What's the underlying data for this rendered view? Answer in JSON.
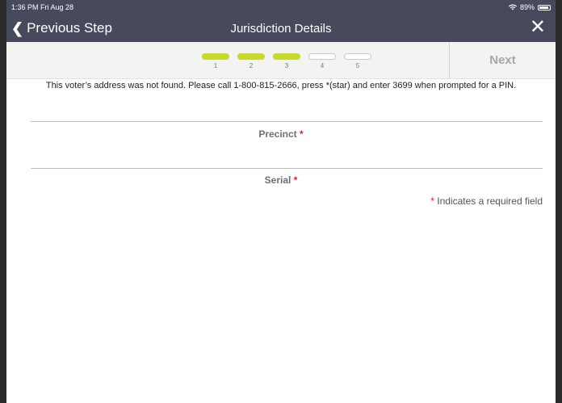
{
  "status_bar": {
    "time_date": "1:36 PM  Fri Aug 28",
    "battery": "89%",
    "wifi_icon": "wifi-icon",
    "battery_icon": "battery-icon"
  },
  "nav": {
    "back_label": "Previous Step",
    "title": "Jurisdiction Details",
    "close_icon": "close-icon"
  },
  "progress": {
    "steps": [
      {
        "label": "1",
        "complete": true
      },
      {
        "label": "2",
        "complete": true
      },
      {
        "label": "3",
        "complete": true
      },
      {
        "label": "4",
        "complete": false
      },
      {
        "label": "5",
        "complete": false
      }
    ],
    "next_label": "Next"
  },
  "content": {
    "message": "This voter’s address was not found. Please call 1-800-815-2666, press *(star) and enter 3699 when prompted for a PIN.",
    "fields": [
      {
        "label": "Precinct",
        "required_mark": "*"
      },
      {
        "label": "Serial",
        "required_mark": "*"
      }
    ],
    "required_note_mark": "*",
    "required_note": "Indicates a required field"
  },
  "colors": {
    "header_bg": "#474a5c",
    "step_done": "#c9d92a",
    "required": "#e02020"
  }
}
